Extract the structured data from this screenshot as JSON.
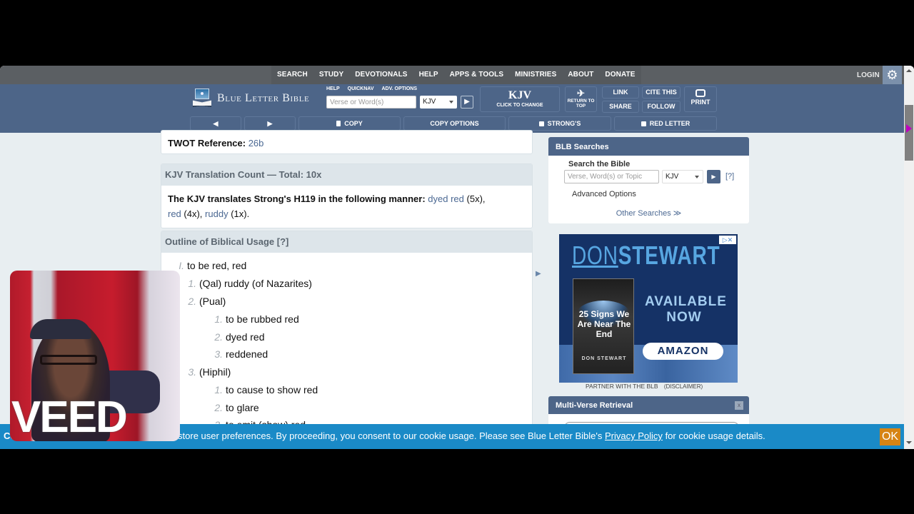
{
  "topnav": {
    "menu": [
      "SEARCH",
      "STUDY",
      "DEVOTIONALS",
      "HELP",
      "APPS & TOOLS",
      "MINISTRIES",
      "ABOUT",
      "DONATE"
    ],
    "login": "LOGIN",
    "settings_icon": "gear-icon"
  },
  "header": {
    "logo_text": "Blue Letter Bible",
    "sublinks": [
      "HELP",
      "QUICKNAV",
      "ADV. OPTIONS"
    ],
    "search_placeholder": "Verse or Word(s)",
    "version": "KJV",
    "version_box": {
      "title": "KJV",
      "subtitle": "CLICK TO CHANGE"
    },
    "return_to_top": "RETURN TO TOP",
    "link": "LINK",
    "share": "SHARE",
    "cite_this": "CITE THIS",
    "follow": "FOLLOW",
    "print": "PRINT"
  },
  "toolbar": {
    "prev": "◀",
    "next": "▶",
    "copy": "COPY",
    "copy_options": "COPY OPTIONS",
    "strongs": "STRONG'S",
    "red_letter": "RED LETTER"
  },
  "content": {
    "twot_label": "TWOT Reference:",
    "twot_value": "26b",
    "translation_count_title": "KJV Translation Count — Total: 10x",
    "translation_intro": "The KJV translates Strong's H119 in the following manner:",
    "translations": [
      {
        "word": "dyed red",
        "count": "(5x),"
      },
      {
        "word": "red",
        "count": "(4x),"
      },
      {
        "word": "ruddy",
        "count": "(1x)."
      }
    ],
    "outline_title": "Outline of Biblical Usage [?]",
    "outline": [
      {
        "num": "I.",
        "text": "to be red, red",
        "level": 0
      },
      {
        "num": "1.",
        "text": "(Qal) ruddy (of Nazarites)",
        "level": 1
      },
      {
        "num": "2.",
        "text": "(Pual)",
        "level": 1
      },
      {
        "num": "1.",
        "text": "to be rubbed red",
        "level": 2
      },
      {
        "num": "2.",
        "text": "dyed red",
        "level": 2
      },
      {
        "num": "3.",
        "text": "reddened",
        "level": 2
      },
      {
        "num": "3.",
        "text": "(Hiphil)",
        "level": 1
      },
      {
        "num": "1.",
        "text": "to cause to show red",
        "level": 2
      },
      {
        "num": "2.",
        "text": "to glare",
        "level": 2
      },
      {
        "num": "3.",
        "text": "to emit (show) red",
        "level": 2
      }
    ]
  },
  "sidebar": {
    "blb_searches": {
      "title": "BLB Searches",
      "search_label": "Search the Bible",
      "placeholder": "Verse, Word(s) or Topic",
      "version": "KJV",
      "help": "[?]",
      "advanced": "Advanced Options",
      "other": "Other Searches ≫"
    },
    "ad": {
      "brand_a": "DON",
      "brand_b": "STEWART",
      "book_title": "25 Signs We Are Near The End",
      "book_author": "DON STEWART",
      "available": "AVAILABLE NOW",
      "button": "AMAZON"
    },
    "partner": "PARTNER WITH THE BLB",
    "disclaimer": "(DISCLAIMER)",
    "multi_verse": {
      "title": "Multi-Verse Retrieval",
      "close": "x"
    }
  },
  "cookie": {
    "text_before": "Co",
    "text_visible": "to store user preferences. By proceeding, you consent to our cookie usage. Please see Blue Letter Bible's",
    "link": "Privacy Policy",
    "text_after": "for cookie usage details.",
    "ok": "OK"
  },
  "overlay": {
    "watermark": "VEED"
  },
  "colors": {
    "header_blue": "#4d6588",
    "topnav_gray": "#5b5f63",
    "cookie_blue": "#1a8ac7",
    "ok_orange": "#d68414",
    "link_blue": "#4c6993"
  }
}
